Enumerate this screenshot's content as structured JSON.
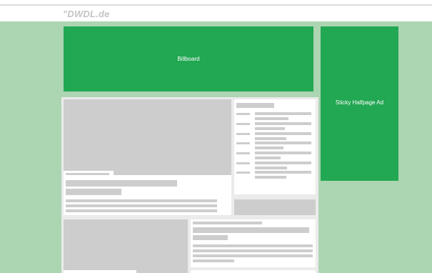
{
  "site": {
    "logo_text": "\"DWDL.de"
  },
  "ads": {
    "billboard_label": "Billboard",
    "halfpage_label": "Sticky Halfpage Ad"
  },
  "colors": {
    "page_background": "#acd5b2",
    "ad_green": "#22a752",
    "placeholder_gray": "#cdcdcd",
    "content_background": "#ebebeb"
  }
}
